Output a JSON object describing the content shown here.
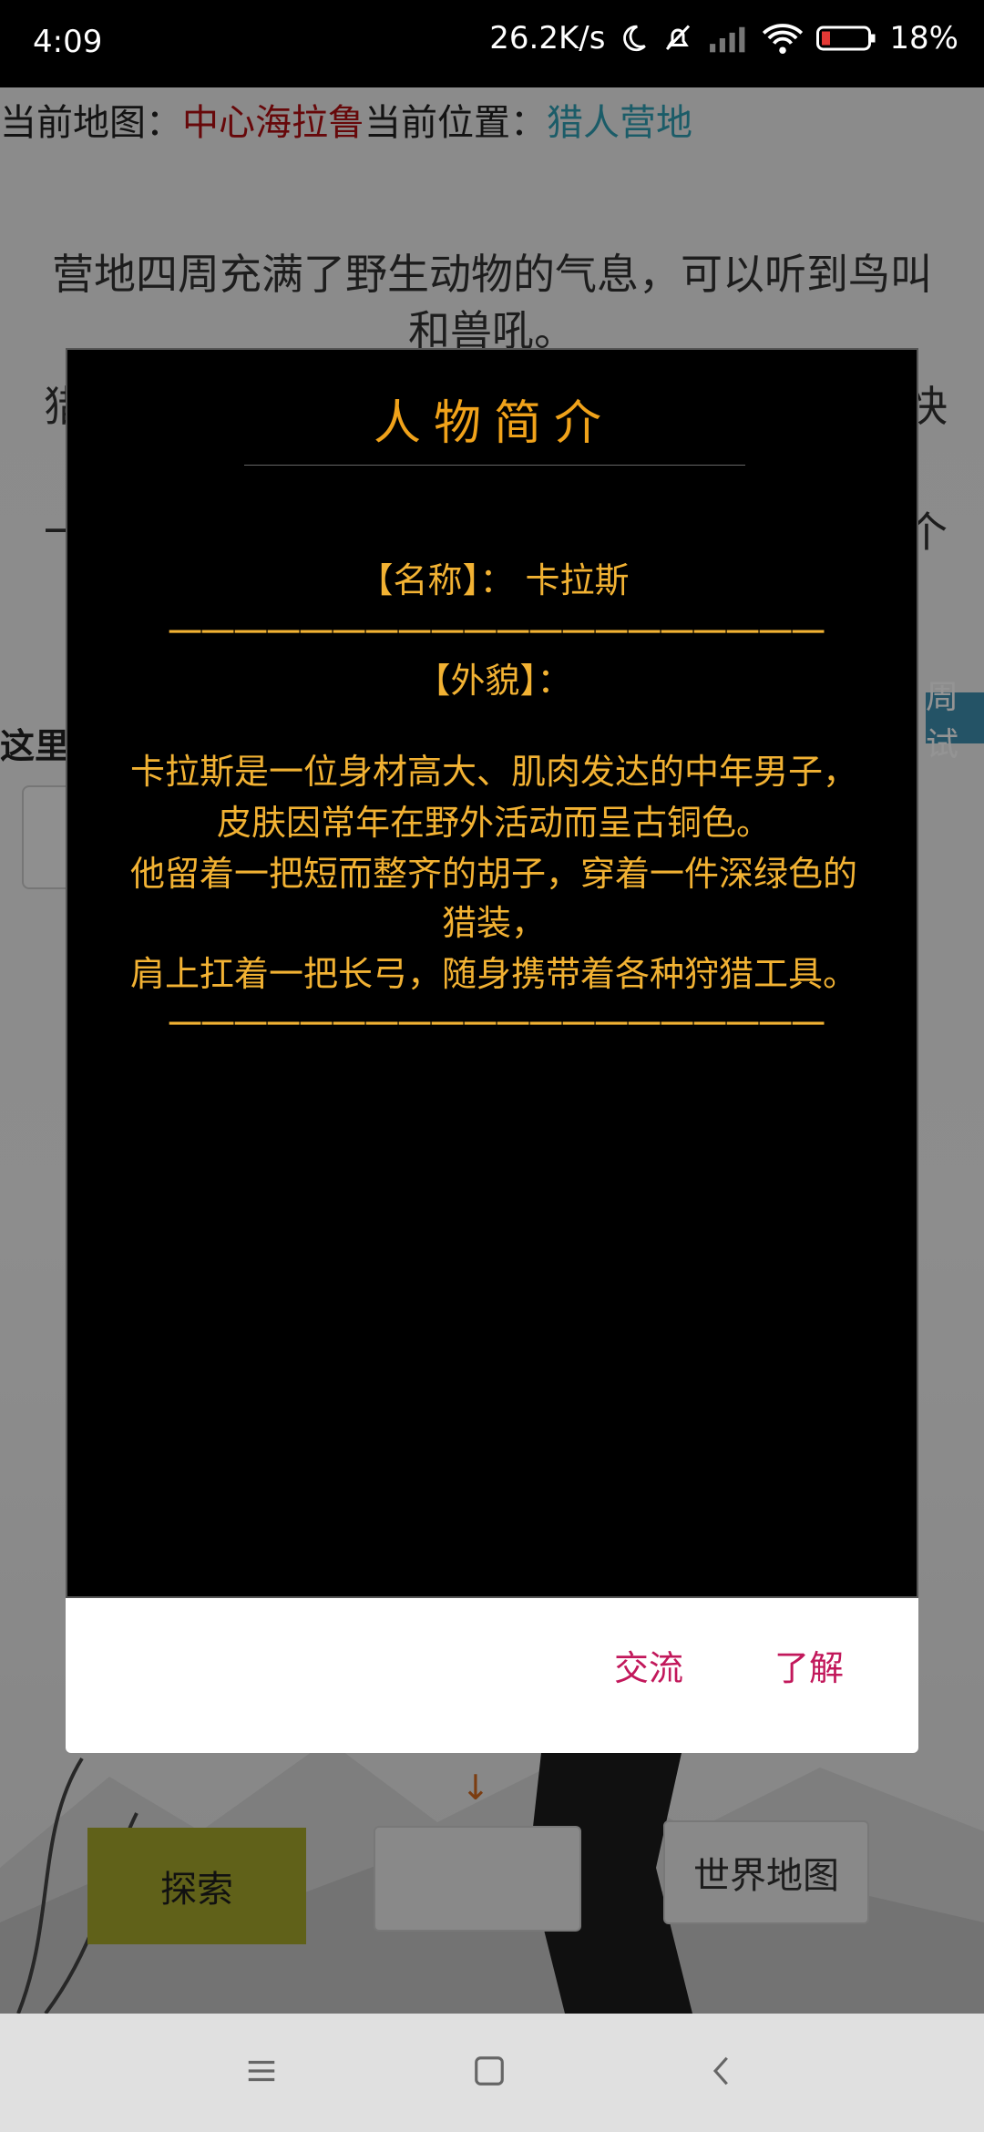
{
  "status_bar": {
    "time": "4:09",
    "net_speed": "26.2K/s",
    "battery_percent": "18%",
    "icons": [
      "moon-icon",
      "bell-off-icon",
      "signal-icon",
      "wifi-icon",
      "battery-icon"
    ]
  },
  "header": {
    "map_label": "当前地图：",
    "map_value": "中心海拉鲁",
    "location_label": "当前位置：",
    "location_value": "猎人营地"
  },
  "background": {
    "description": "营地四周充满了野生动物的气息，可以听到鸟叫和兽吼。",
    "partial_left": "猎",
    "partial_right": "快",
    "dash_left": "一",
    "dash_right": "个",
    "here_label": "这里",
    "side_tag": "周试",
    "arrow": "↓",
    "explore_button": "探索",
    "world_map_button": "世界地图"
  },
  "dialog": {
    "title": "人物简介",
    "name_line": "【名称】：  卡拉斯",
    "separator": "一一一一一一一一一一一一一一一一一一一一",
    "appearance_label": "【外貌】：",
    "appearance_lines": [
      "卡拉斯是一位身材高大、肌肉发达的中年男子，",
      "皮肤因常年在野外活动而呈古铜色。",
      "他留着一把短而整齐的胡子，穿着一件深绿色的",
      "猎装，",
      "肩上扛着一把长弓，随身携带着各种狩猎工具。"
    ],
    "buttons": {
      "talk": "交流",
      "understand": "了解"
    }
  },
  "nav_bar": {
    "icons": [
      "menu-icon",
      "home-icon",
      "back-icon"
    ]
  },
  "colors": {
    "accent_gold": "#f2b233",
    "map_red": "#b10f12",
    "location_teal": "#2f9fb3",
    "dialog_button": "#c2185b",
    "explore_button": "#a5a82b"
  }
}
